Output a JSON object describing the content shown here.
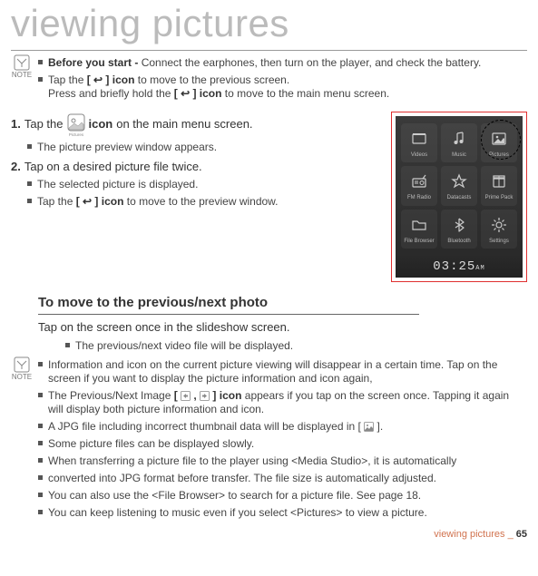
{
  "title": "viewing pictures",
  "notes_top": {
    "line1_bold": "Before you start - ",
    "line1_rest": "Connect the earphones, then turn on the player, and check the battery.",
    "line2a_a": "Tap the ",
    "line2a_b": "[ ↩ ] icon",
    "line2a_c": " to move to the previous screen.",
    "line2b_a": "Press and briefly hold the ",
    "line2b_b": "[ ↩ ] icon",
    "line2b_c": " to move to the main menu screen."
  },
  "steps": {
    "s1_num": "1.",
    "s1_a": "Tap the ",
    "s1_b": " icon",
    "s1_c": " on the main menu screen.",
    "s1_sub": "The picture preview window appears.",
    "s2_num": "2.",
    "s2_txt": "Tap on a desired picture file twice.",
    "s2_sub1": "The selected picture is displayed.",
    "s2_sub2_a": "Tap the ",
    "s2_sub2_b": "[ ↩ ] icon",
    "s2_sub2_c": " to move to the preview window."
  },
  "section": {
    "heading": "To move to the previous/next photo",
    "body": "Tap on the screen once in the slideshow screen.",
    "sub": "The previous/next video file will be displayed."
  },
  "notes_bottom": [
    "Information and icon on the current picture viewing will disappear in a certain time. Tap on the screen if you want to display the picture information and icon again,",
    "",
    "A JPG file including incorrect thumbnail data will be displayed in [       ].",
    "Some picture files can be displayed slowly.",
    "When transferring a picture file to the player using <Media Studio>, it is automatically",
    "converted into JPG format before transfer. The file size is automatically adjusted.",
    "You can also use the <File Browser> to search for a picture file. See page 18.",
    "You can keep listening to music even if you select <Pictures> to view a picture."
  ],
  "note_prevnext_a": "The Previous/Next Image ",
  "note_prevnext_b": "[      ,      ] icon",
  "note_prevnext_c": " appears if you tap on the screen once. Tapping it again will display both picture information and icon.",
  "device": {
    "tiles": [
      "Videos",
      "Music",
      "Pictures",
      "FM Radio",
      "Datacasts",
      "Prime Pack",
      "File Browser",
      "Bluetooth",
      "Settings"
    ],
    "clock": "03:25",
    "ampm": "AM"
  },
  "pictures_inline_label": "Pictures",
  "note_label": "NOTE",
  "footer": {
    "text": "viewing pictures _ ",
    "page": "65"
  }
}
